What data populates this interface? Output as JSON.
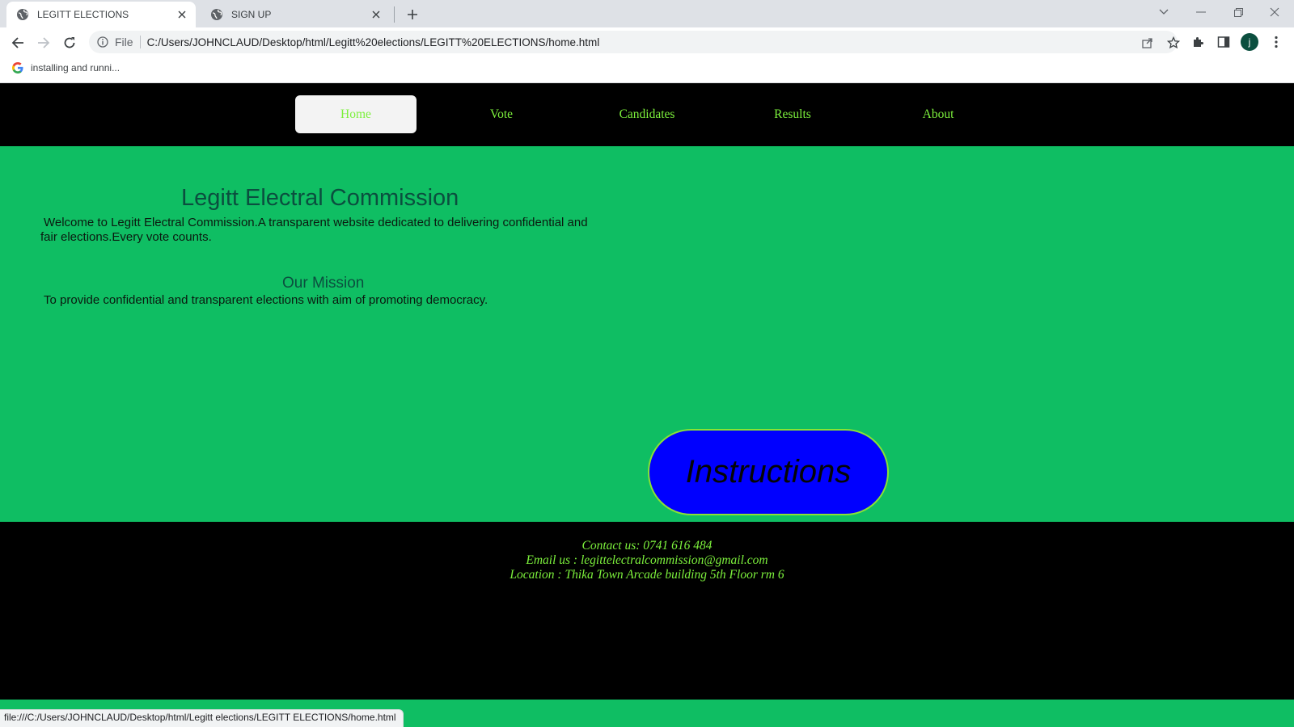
{
  "browser": {
    "tabs": [
      {
        "title": "LEGITT ELECTIONS",
        "active": true
      },
      {
        "title": "SIGN UP",
        "active": false
      }
    ],
    "omnibox": {
      "scheme_label": "File",
      "url": "C:/Users/JOHNCLAUD/Desktop/html/Legitt%20elections/LEGITT%20ELECTIONS/home.html"
    },
    "profile_initial": "j",
    "bookmarks": [
      {
        "label": "installing and runni..."
      }
    ],
    "status_url": "file:///C:/Users/JOHNCLAUD/Desktop/html/Legitt elections/LEGITT ELECTIONS/home.html"
  },
  "page": {
    "nav": [
      {
        "label": "Home",
        "active": true
      },
      {
        "label": "Vote",
        "active": false
      },
      {
        "label": "Candidates",
        "active": false
      },
      {
        "label": "Results",
        "active": false
      },
      {
        "label": "About",
        "active": false
      }
    ],
    "hero": {
      "title": "Legitt Electral Commission",
      "welcome": "Welcome to Legitt Electral Commission.A transparent website dedicated to delivering confidential and fair elections.Every vote counts.",
      "mission_title": "Our Mission",
      "mission_text": "To provide confidential and transparent elections with aim of promoting democracy."
    },
    "instructions_button": "Instructions",
    "footer": {
      "contact": "Contact us: 0741 616 484",
      "email": "Email us : legittelectralcommission@gmail.com",
      "location": "Location : Thika Town Arcade building 5th Floor rm 6"
    }
  },
  "colors": {
    "page_green": "#0fbe63",
    "nav_black": "#000000",
    "nav_text_green": "#7cf03c",
    "title_dark_green": "#0b4f3f",
    "button_blue": "#0000ff"
  }
}
